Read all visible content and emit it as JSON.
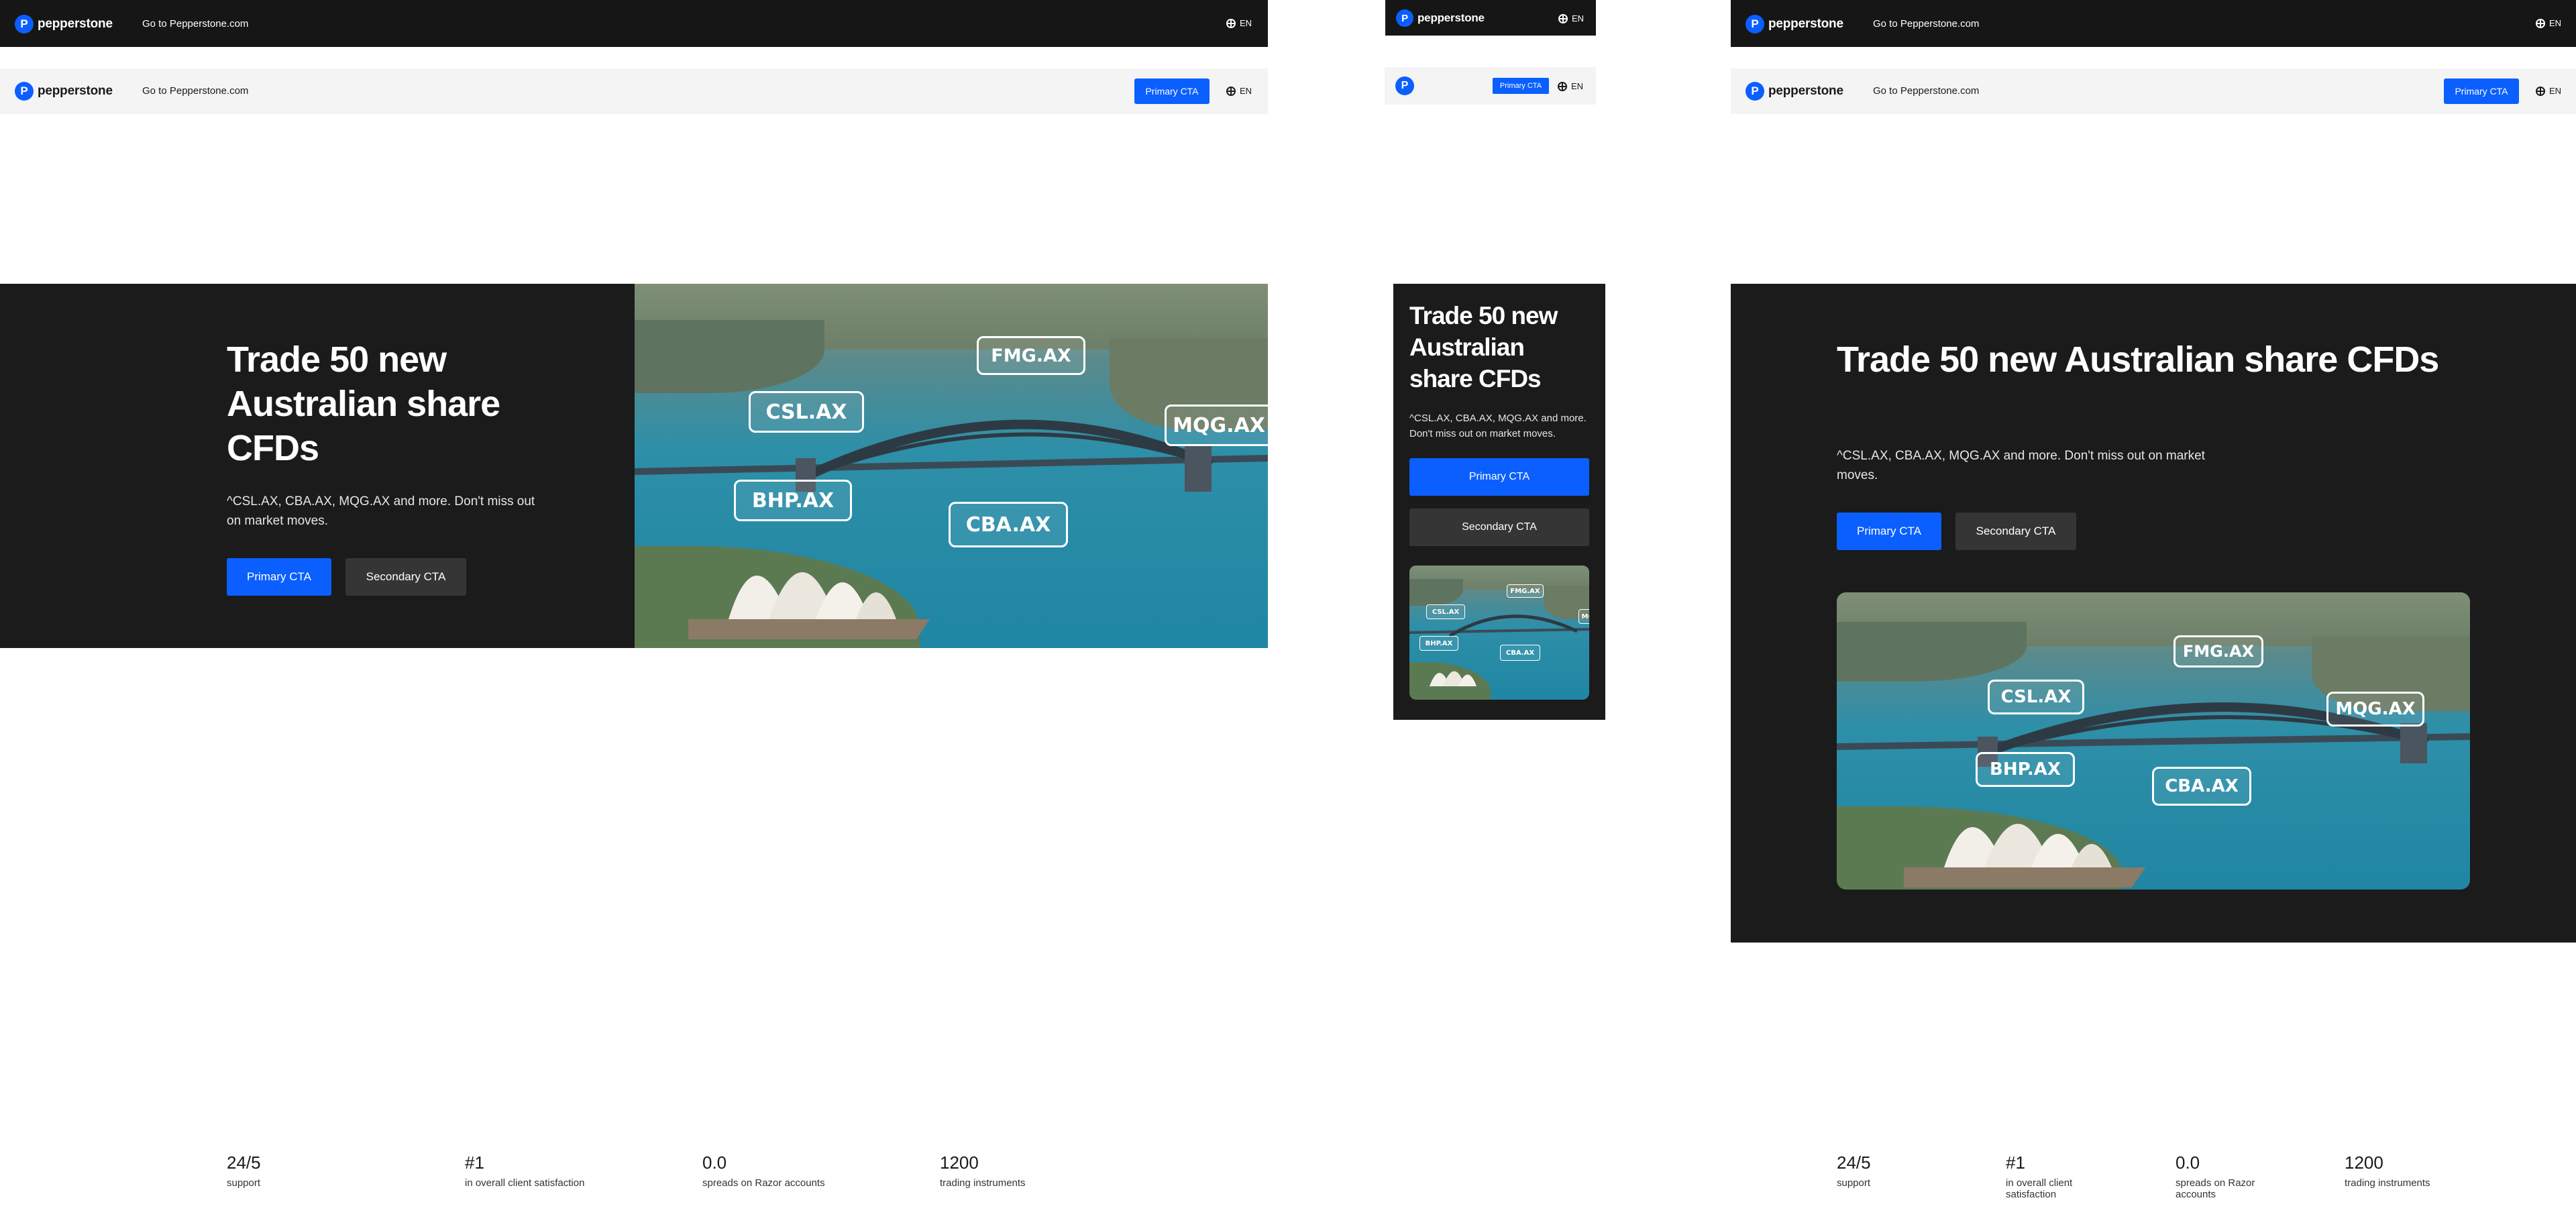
{
  "brand": {
    "name": "pepperstone",
    "mark": "P",
    "accent": "#0b5fff"
  },
  "header": {
    "goto_label": "Go to Pepperstone.com",
    "lang_label": "EN",
    "cta_label": "Primary CTA"
  },
  "hero": {
    "title": "Trade 50 new Australian share CFDs",
    "description": "^CSL.AX, CBA.AX, MQG.AX and more. Don't miss out on market moves.",
    "primary_cta": "Primary CTA",
    "secondary_cta": "Secondary CTA",
    "tickers": [
      "FMG.AX",
      "CSL.AX",
      "MQG.AX",
      "BHP.AX",
      "CBA.AX"
    ]
  },
  "stats": [
    {
      "value": "24/5",
      "label": "support"
    },
    {
      "value": "#1",
      "label": "in overall client satisfaction"
    },
    {
      "value": "0.0",
      "label": "spreads on Razor accounts"
    },
    {
      "value": "1200",
      "label": "trading instruments"
    }
  ]
}
